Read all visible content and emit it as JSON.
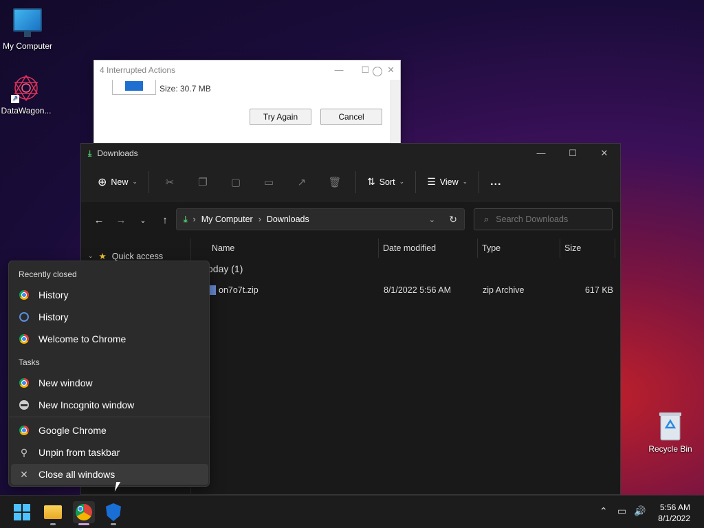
{
  "desktop": {
    "icons": [
      {
        "label": "My Computer"
      },
      {
        "label": "DataWagon..."
      },
      {
        "label": "Recycle Bin"
      }
    ]
  },
  "dialog": {
    "title": "4 Interrupted Actions",
    "size_text": "Size: 30.7 MB",
    "try_again": "Try Again",
    "cancel": "Cancel"
  },
  "explorer": {
    "title": "Downloads",
    "toolbar": {
      "new": "New",
      "sort": "Sort",
      "view": "View",
      "more": "..."
    },
    "address": {
      "root": "My Computer",
      "current": "Downloads"
    },
    "search_placeholder": "Search Downloads",
    "nav": {
      "quick_access": "Quick access"
    },
    "columns": [
      "Name",
      "Date modified",
      "Type",
      "Size"
    ],
    "group": "oday (1)",
    "files": [
      {
        "name": "on7o7t.zip",
        "date": "8/1/2022 5:56 AM",
        "type": "zip Archive",
        "size": "617 KB"
      }
    ]
  },
  "jumplist": {
    "recently_closed_header": "Recently closed",
    "recently_closed": [
      {
        "label": "History",
        "icon": "chrome-icon"
      },
      {
        "label": "History",
        "icon": "history-icon"
      },
      {
        "label": "Welcome to Chrome",
        "icon": "chrome-icon"
      }
    ],
    "tasks_header": "Tasks",
    "tasks": [
      {
        "label": "New window",
        "icon": "chrome-icon"
      },
      {
        "label": "New Incognito window",
        "icon": "incognito-icon"
      }
    ],
    "pinned": [
      {
        "label": "Google Chrome",
        "icon": "chrome-icon"
      },
      {
        "label": "Unpin from taskbar",
        "icon": "unpin-icon"
      },
      {
        "label": "Close all windows",
        "icon": "close-icon"
      }
    ]
  },
  "taskbar": {
    "time": "5:56 AM",
    "date": "8/1/2022",
    "accent": "#4cc2ff"
  }
}
